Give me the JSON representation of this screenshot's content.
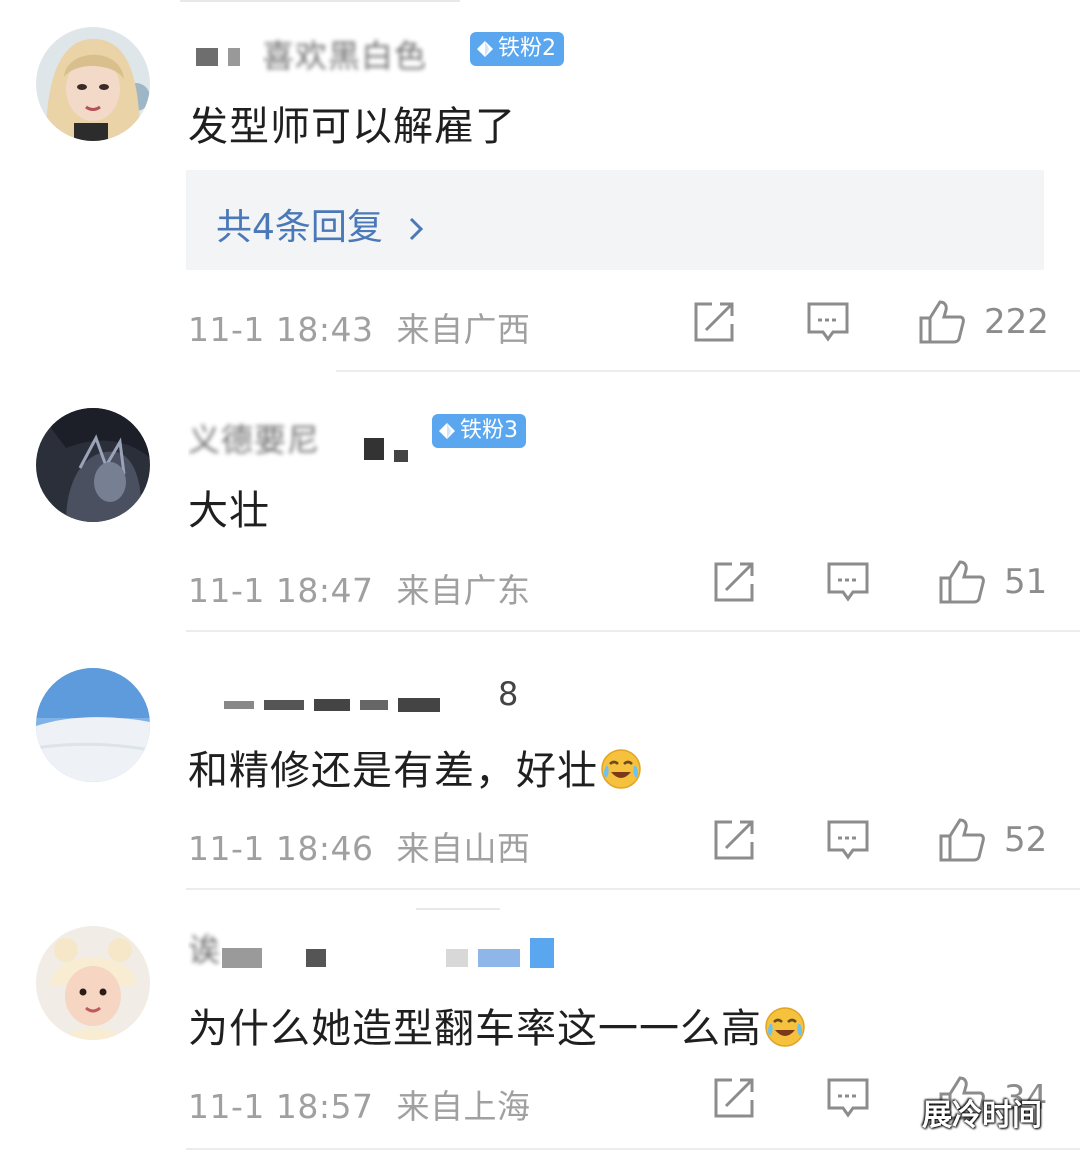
{
  "colors": {
    "badge_blue": "#5aa7f0",
    "reply_link": "#4b78b8",
    "meta_gray": "#a0a0a0",
    "emoji_yellow": "#f6c23e"
  },
  "comments": [
    {
      "username": "喜欢黑白色",
      "badge": "铁粉2",
      "text": "发型师可以解雇了",
      "reply_link": "共4条回复",
      "timestamp": "11-1 18:43",
      "location": "来自广西",
      "likes": "222",
      "avatar_icon": "avatar-blonde-girl"
    },
    {
      "username": "义德要尼",
      "badge": "铁粉3",
      "text": "大壮",
      "timestamp": "11-1 18:47",
      "location": "来自广东",
      "likes": "51",
      "avatar_icon": "avatar-dark-anime"
    },
    {
      "username": "8",
      "text": "和精修还是有差，好壮",
      "emoji": "laugh-cry-emoji",
      "timestamp": "11-1 18:46",
      "location": "来自山西",
      "likes": "52",
      "avatar_icon": "avatar-snow-sky"
    },
    {
      "username": "诶",
      "text": "为什么她造型翻车率这一一么高",
      "emoji": "laugh-cry-emoji",
      "timestamp": "11-1 18:57",
      "location": "来自上海",
      "likes": "34",
      "avatar_icon": "avatar-bear-hat-child"
    }
  ],
  "watermark": "展冷时间"
}
